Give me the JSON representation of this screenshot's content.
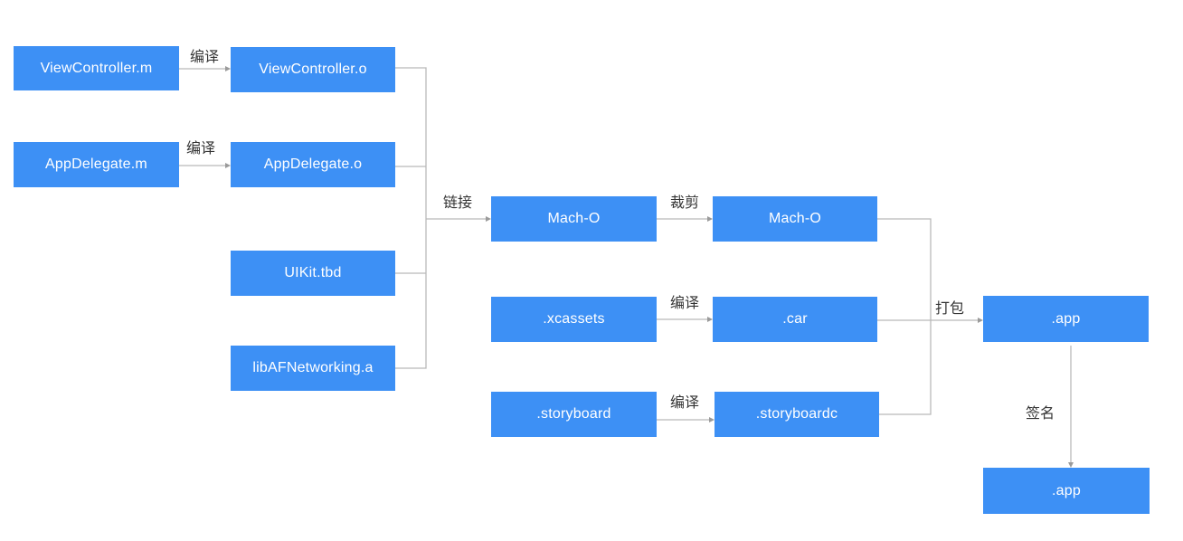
{
  "diagram": {
    "theme": {
      "node_color": "#3d90f5",
      "node_text_color": "#ffffff",
      "edge_color": "#b9b9b9",
      "label_color": "#333333"
    },
    "nodes": [
      {
        "id": "viewcontroller_m",
        "label": "ViewController.m"
      },
      {
        "id": "viewcontroller_o",
        "label": "ViewController.o"
      },
      {
        "id": "appdelegate_m",
        "label": "AppDelegate.m"
      },
      {
        "id": "appdelegate_o",
        "label": "AppDelegate.o"
      },
      {
        "id": "uikit_tbd",
        "label": "UIKit.tbd"
      },
      {
        "id": "libafnetworking_a",
        "label": "libAFNetworking.a"
      },
      {
        "id": "macho_linked",
        "label": "Mach-O"
      },
      {
        "id": "macho_stripped",
        "label": "Mach-O"
      },
      {
        "id": "xcassets",
        "label": ".xcassets"
      },
      {
        "id": "car",
        "label": ".car"
      },
      {
        "id": "storyboard",
        "label": ".storyboard"
      },
      {
        "id": "storyboardc",
        "label": ".storyboardc"
      },
      {
        "id": "app_packaged",
        "label": ".app"
      },
      {
        "id": "app_signed",
        "label": ".app"
      }
    ],
    "edge_labels": {
      "compile_vc": "编译",
      "compile_ad": "编译",
      "link": "链接",
      "strip": "裁剪",
      "compile_assets": "编译",
      "compile_storyboard": "编译",
      "package": "打包",
      "sign": "签名"
    },
    "edges": [
      {
        "from": "viewcontroller_m",
        "to": "viewcontroller_o",
        "label": "编译"
      },
      {
        "from": "appdelegate_m",
        "to": "appdelegate_o",
        "label": "编译"
      },
      {
        "from": [
          "viewcontroller_o",
          "appdelegate_o",
          "uikit_tbd",
          "libafnetworking_a"
        ],
        "to": "macho_linked",
        "label": "链接"
      },
      {
        "from": "macho_linked",
        "to": "macho_stripped",
        "label": "裁剪"
      },
      {
        "from": "xcassets",
        "to": "car",
        "label": "编译"
      },
      {
        "from": "storyboard",
        "to": "storyboardc",
        "label": "编译"
      },
      {
        "from": [
          "macho_stripped",
          "car",
          "storyboardc"
        ],
        "to": "app_packaged",
        "label": "打包"
      },
      {
        "from": "app_packaged",
        "to": "app_signed",
        "label": "签名"
      }
    ]
  }
}
